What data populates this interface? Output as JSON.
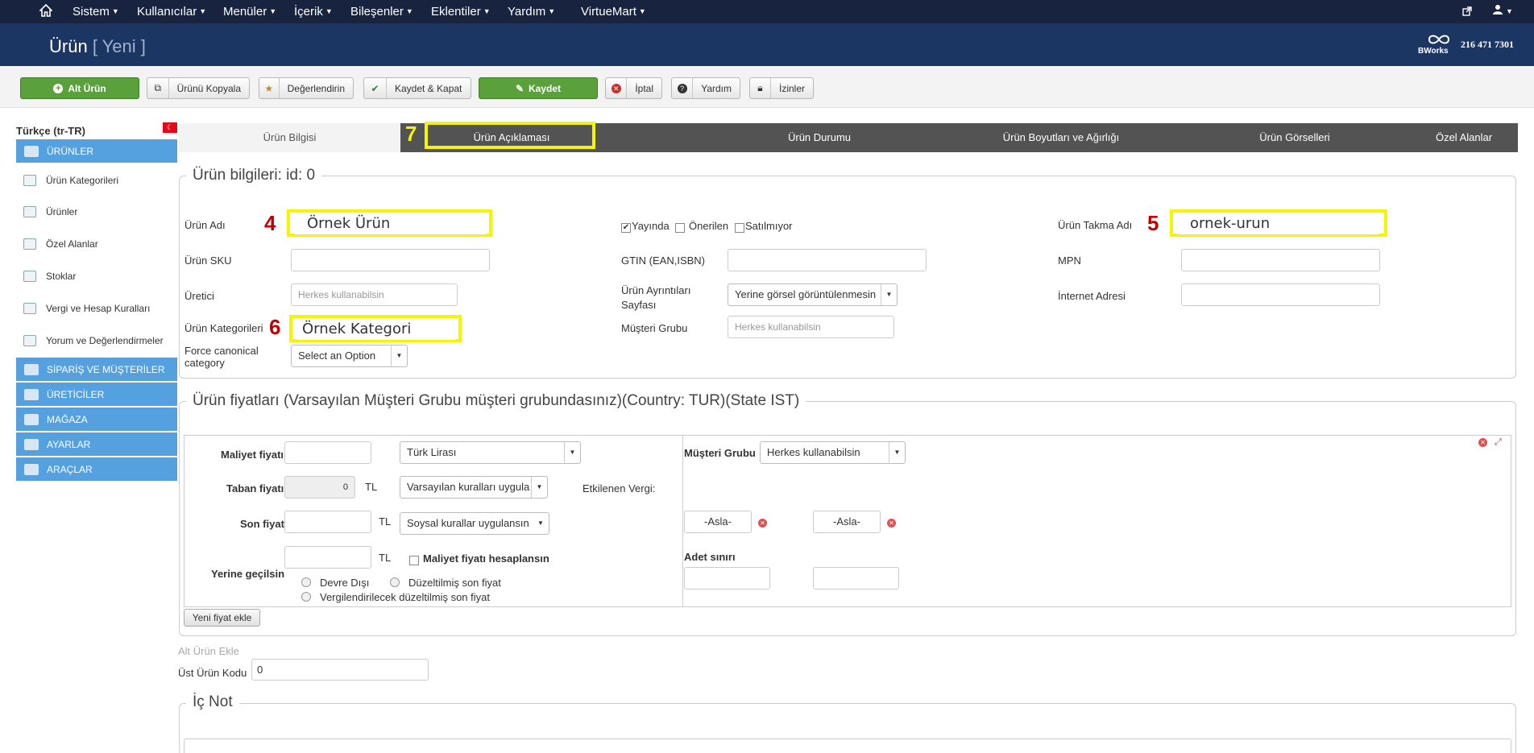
{
  "topnav": {
    "items": [
      "Sistem",
      "Kullanıcılar",
      "Menüler",
      "İçerik",
      "Bileşenler",
      "Eklentiler",
      "Yardım",
      "VirtueMart"
    ]
  },
  "header": {
    "title": "Ürün",
    "subtitle": "[ Yeni ]",
    "brand": "BWorks",
    "phone": "216 471 7301"
  },
  "toolbar": {
    "alt_urun": "Alt Ürün",
    "kopyala": "Ürünü Kopyala",
    "degerlendirin": "Değerlendirin",
    "kaydet_kapat": "Kaydet & Kapat",
    "kaydet": "Kaydet",
    "iptal": "İptal",
    "yardim": "Yardım",
    "izinler": "İzinler"
  },
  "sidebar": {
    "language": "Türkçe (tr-TR)",
    "flag": "☾",
    "sections": [
      "ÜRÜNLER",
      "SİPARİŞ VE MÜŞTERİLER",
      "ÜRETİCİLER",
      "MAĞAZA",
      "AYARLAR",
      "ARAÇLAR"
    ],
    "items": [
      "Ürün Kategorileri",
      "Ürünler",
      "Özel Alanlar",
      "Stoklar",
      "Vergi ve Hesap Kuralları",
      "Yorum ve Değerlendirmeler"
    ]
  },
  "tabs": [
    "Ürün Bilgisi",
    "Ürün Açıklaması",
    "Ürün Durumu",
    "Ürün Boyutları ve Ağırlığı",
    "Ürün Görselleri",
    "Özel Alanlar"
  ],
  "annotations": {
    "n4": "4",
    "n5": "5",
    "n6": "6",
    "n7": "7"
  },
  "info": {
    "legend": "Ürün bilgileri: id: 0",
    "urun_adi_label": "Ürün Adı",
    "urun_adi_value": "Örnek Ürün",
    "urun_sku_label": "Ürün SKU",
    "uretici_label": "Üretici",
    "uretici_placeholder": "Herkes kullanabilsin",
    "kategoriler_label": "Ürün Kategorileri",
    "kategoriler_value": "Örnek Kategori",
    "canonical_label_1": "Force canonical",
    "canonical_label_2": "category",
    "canonical_value": "Select an Option",
    "yayinda": "Yayında",
    "onerilen": "Önerilen",
    "satilmiyor": "Satılmıyor",
    "gtin_label": "GTIN (EAN,ISBN)",
    "ayrinti_label_1": "Ürün Ayrıntıları",
    "ayrinti_label_2": "Sayfası",
    "ayrinti_value": "Yerine görsel görüntülenmesin",
    "musteri_grubu_label": "Müşteri Grubu",
    "musteri_grubu_placeholder": "Herkes kullanabilsin",
    "takma_adi_label": "Ürün Takma Adı",
    "takma_adi_value": "ornek-urun",
    "mpn_label": "MPN",
    "internet_label": "İnternet Adresi"
  },
  "prices": {
    "legend": "Ürün fiyatları (Varsayılan Müşteri Grubu müşteri grubundasınız)(Country: TUR)(State IST)",
    "maliyet_label": "Maliyet fiyatı",
    "currency": "Türk Lirası",
    "taban_label": "Taban fiyatı",
    "taban_value": "0",
    "tl": "TL",
    "taban_rule": "Varsayılan kuralları uygula",
    "etkilenen_vergi": "Etkilenen Vergi:",
    "son_label": "Son fiyat",
    "son_rule": "Soysal kurallar uygulansın",
    "yerine_label": "Yerine geçilsin",
    "maliyet_hesap": "Maliyet fiyatı hesaplansın",
    "devre_disi": "Devre Dışı",
    "duzeltilmis": "Düzeltilmiş son fiyat",
    "vergilendirilecek": "Vergilendirilecek düzeltilmiş son fiyat",
    "musteri_grubu_label": "Müşteri Grubu",
    "musteri_grubu_value": "Herkes kullanabilsin",
    "asla1": "-Asla-",
    "asla2": "-Asla-",
    "adet_label": "Adet sınırı",
    "yeni_fiyat": "Yeni fiyat ekle"
  },
  "bottom": {
    "alt_urun_ekle": "Alt Ürün Ekle",
    "ust_kod_label": "Üst Ürün Kodu",
    "ust_kod_value": "0",
    "ic_not": "İç Not"
  }
}
